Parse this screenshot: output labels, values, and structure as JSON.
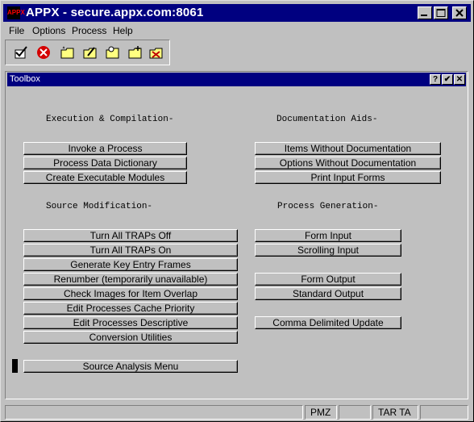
{
  "window": {
    "title": "APPX - secure.appx.com:8061",
    "logo_text": "APPX"
  },
  "menu": [
    "File",
    "Options",
    "Process",
    "Help"
  ],
  "toolbar_icons": [
    "check-icon",
    "stop-icon",
    "folder-star-icon",
    "folder-edit-icon",
    "folder-search-icon",
    "folder-add-icon",
    "folder-delete-icon"
  ],
  "toolbox": {
    "title": "Toolbox",
    "title_buttons": [
      "?",
      "✔",
      "✕"
    ],
    "sections": {
      "execution": "Execution & Compilation-",
      "documentation": "Documentation Aids-",
      "source": "Source Modification-",
      "generation": "Process Generation-"
    },
    "execution_buttons": [
      "Invoke a Process",
      "Process Data Dictionary",
      "Create Executable Modules"
    ],
    "documentation_buttons": [
      "Items Without Documentation",
      "Options Without Documentation",
      "Print Input Forms"
    ],
    "source_buttons": [
      "Turn All TRAPs Off",
      "Turn All TRAPs On",
      "Generate Key Entry Frames",
      "Renumber (temporarily unavailable)",
      "Check Images for Item Overlap",
      "Edit Processes Cache Priority",
      "Edit Processes Descriptive",
      "Conversion Utilities"
    ],
    "generation_buttons": [
      "Form Input",
      "Scrolling Input",
      "Form Output",
      "Standard Output",
      "Comma Delimited Update"
    ],
    "analysis_button": "Source Analysis Menu"
  },
  "status_bar": {
    "segments": [
      "",
      "",
      "PMZ",
      "",
      "TAR TA",
      ""
    ]
  }
}
